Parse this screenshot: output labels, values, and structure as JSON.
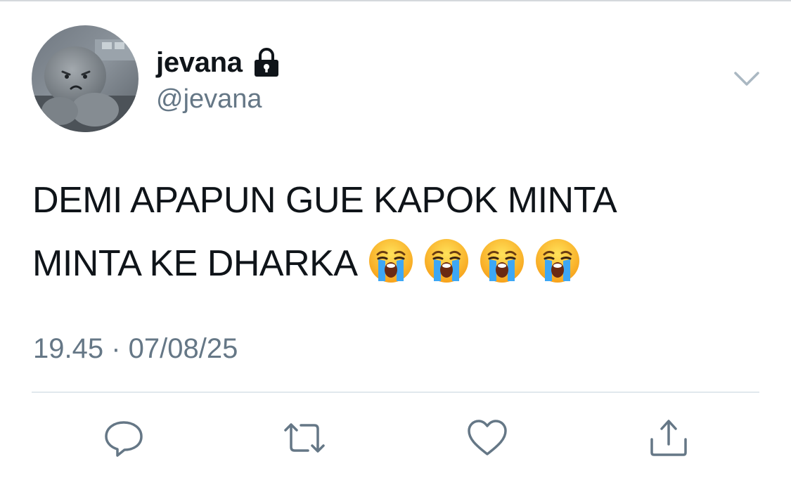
{
  "user": {
    "display_name": "jevana",
    "handle": "@jevana",
    "protected_icon": "lock-icon",
    "avatar_icon": "gray-plush-toy-avatar"
  },
  "tweet": {
    "lines": [
      "DEMI APAPUN GUE KAPOK MINTA",
      "MINTA KE DHARKA"
    ],
    "emoji": [
      "😭",
      "😭",
      "😭",
      "😭"
    ],
    "emoji_name": "loudly-crying-face",
    "timestamp": "19.45 · 07/08/25"
  },
  "actions": {
    "reply_icon": "reply-icon",
    "retweet_icon": "retweet-icon",
    "like_icon": "heart-icon",
    "share_icon": "share-icon",
    "menu_icon": "chevron-down-icon"
  },
  "colors": {
    "text": "#0f1419",
    "secondary": "#657786",
    "divider": "#e1e8ed",
    "icon": "#657786",
    "background": "#ffffff"
  }
}
